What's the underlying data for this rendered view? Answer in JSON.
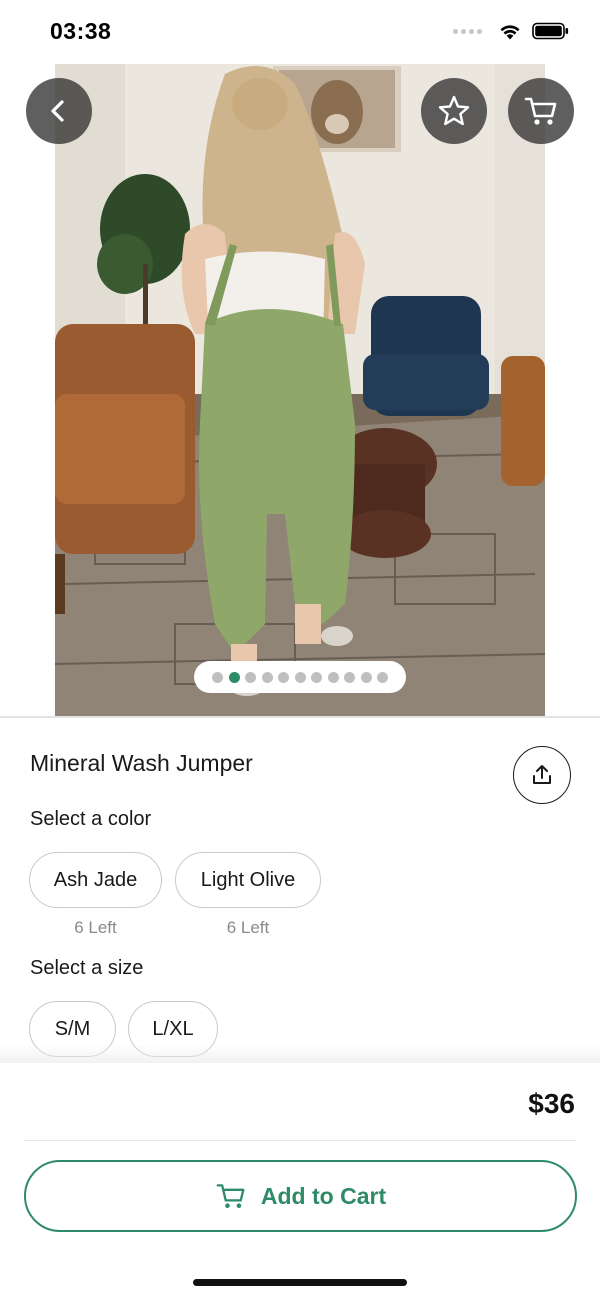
{
  "status_bar": {
    "time": "03:38"
  },
  "hero": {
    "page_count": 11,
    "active_page": 1,
    "image_description_icon": "product-photo"
  },
  "product": {
    "title": "Mineral Wash Jumper",
    "color_label": "Select a color",
    "colors": [
      {
        "name": "Ash Jade",
        "stock": "6 Left"
      },
      {
        "name": "Light Olive",
        "stock": "6 Left"
      }
    ],
    "size_label": "Select a size",
    "sizes": [
      "S/M",
      "L/XL"
    ]
  },
  "checkout": {
    "price": "$36",
    "add_to_cart_label": "Add to Cart"
  },
  "colors": {
    "accent": "#2e8b67",
    "button_overlay": "#323232",
    "chip_border": "#c9c9c9",
    "muted_text": "#8a8a8a"
  },
  "icons": {
    "back": "chevron-left-icon",
    "favorite": "star-icon",
    "cart": "cart-icon",
    "share": "share-icon",
    "wifi": "wifi-icon",
    "battery": "battery-icon"
  }
}
